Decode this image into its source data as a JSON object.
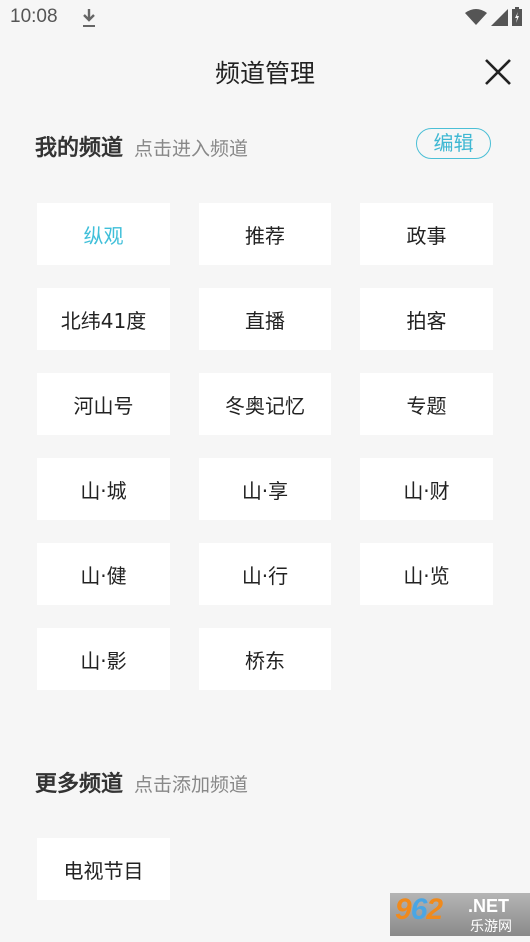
{
  "status_bar": {
    "time": "10:08",
    "icons": [
      "download-icon",
      "wifi-icon",
      "signal-icon",
      "battery-charging-icon"
    ]
  },
  "header": {
    "title": "频道管理",
    "close_icon": "close-icon"
  },
  "my_channels": {
    "title": "我的频道",
    "hint": "点击进入频道",
    "edit_label": "编辑",
    "accent_color": "#3fbfd9",
    "items": [
      {
        "label": "纵观",
        "active": true
      },
      {
        "label": "推荐",
        "active": false
      },
      {
        "label": "政事",
        "active": false
      },
      {
        "label": "北纬41度",
        "active": false
      },
      {
        "label": "直播",
        "active": false
      },
      {
        "label": "拍客",
        "active": false
      },
      {
        "label": "河山号",
        "active": false
      },
      {
        "label": "冬奥记忆",
        "active": false
      },
      {
        "label": "专题",
        "active": false
      },
      {
        "label": "山·城",
        "active": false
      },
      {
        "label": "山·享",
        "active": false
      },
      {
        "label": "山·财",
        "active": false
      },
      {
        "label": "山·健",
        "active": false
      },
      {
        "label": "山·行",
        "active": false
      },
      {
        "label": "山·览",
        "active": false
      },
      {
        "label": "山·影",
        "active": false
      },
      {
        "label": "桥东",
        "active": false
      }
    ]
  },
  "more_channels": {
    "title": "更多频道",
    "hint": "点击添加频道",
    "items": [
      {
        "label": "电视节目"
      }
    ]
  },
  "watermark": {
    "num_a": "9",
    "num_b": "6",
    "num_c": "2",
    "net": ".NET",
    "cn": "乐游网"
  }
}
